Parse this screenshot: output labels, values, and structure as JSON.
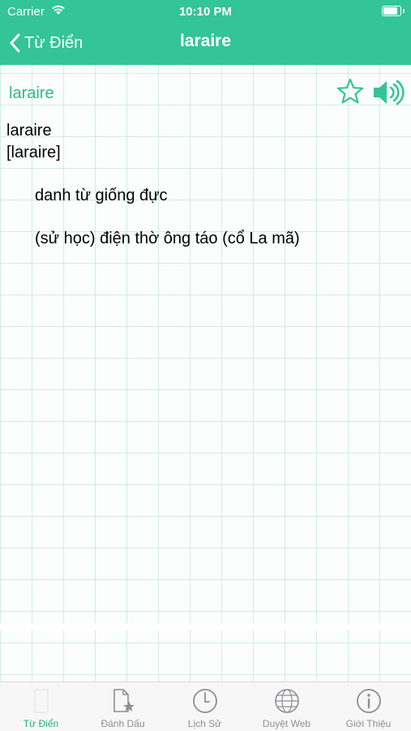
{
  "status": {
    "carrier": "Carrier",
    "time": "10:10 PM"
  },
  "nav": {
    "back_label": "Từ Điển",
    "title": "laraire"
  },
  "entry": {
    "headword": "laraire",
    "word": "laraire",
    "phonetic": "[laraire]",
    "part_of_speech": "danh từ giống đực",
    "definition": "(sử học) điện thờ ông táo (cổ La mã)"
  },
  "tabs": [
    {
      "label": "Từ Điển",
      "icon": "dictionary-icon",
      "active": true
    },
    {
      "label": "Đánh Dấu",
      "icon": "bookmark-icon",
      "active": false
    },
    {
      "label": "Lịch Sử",
      "icon": "clock-icon",
      "active": false
    },
    {
      "label": "Duyệt Web",
      "icon": "globe-icon",
      "active": false
    },
    {
      "label": "Giới Thiệu",
      "icon": "info-icon",
      "active": false
    }
  ],
  "colors": {
    "accent": "#33c497",
    "headword": "#33b58f",
    "tab_active": "#1fb583",
    "tab_inactive": "#8e8e93"
  }
}
